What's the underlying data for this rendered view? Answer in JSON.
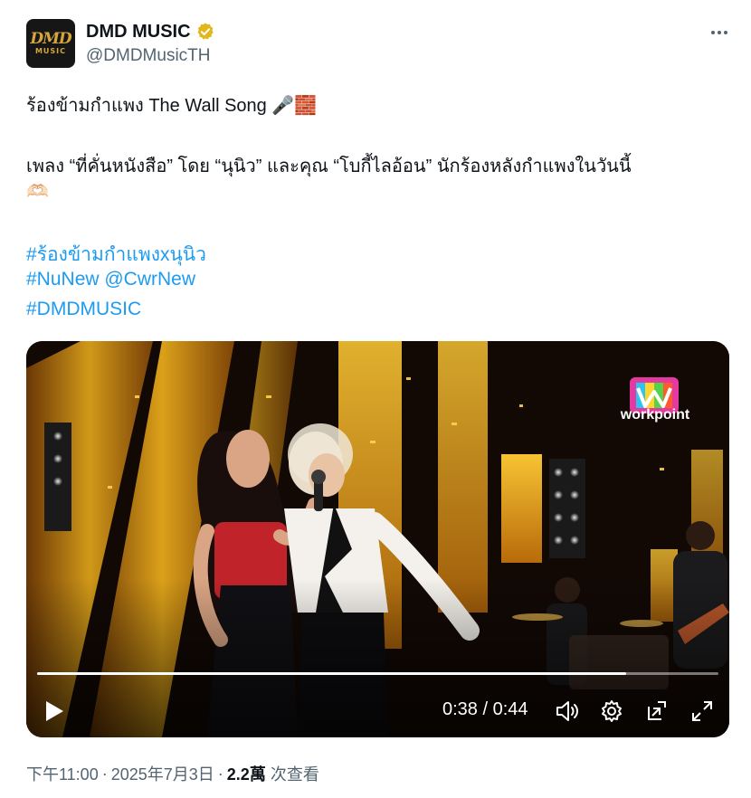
{
  "author": {
    "display_name": "DMD MUSIC",
    "handle": "@DMDMusicTH",
    "avatar_logo_text": "DMD",
    "avatar_logo_subtext": "MUSIC",
    "verified_badge": "gold-verified-icon"
  },
  "tweet": {
    "line1": "ร้องข้ามกำแพง The Wall Song 🎤🧱",
    "line2": "เพลง “ที่คั่นหนังสือ” โดย “นุนิว” และคุณ “โบกี้ไลอ้อน” นักร้องหลังกำแพงในวันนี้",
    "line3": "🫶🏻",
    "hashtags": [
      "#ร้องข้ามกำแพงxนุนิว",
      "#NuNew @CwrNew",
      "#DMDMUSIC"
    ]
  },
  "video": {
    "channel_watermark": "workpoint",
    "time_display": "0:38 / 0:44",
    "progress": 0.864,
    "controls": [
      "play-icon",
      "volume-icon",
      "settings-icon",
      "pip-icon",
      "fullscreen-icon"
    ]
  },
  "meta": {
    "time": "下午11:00",
    "date": "2025年7月3日",
    "separator": "·",
    "views_count": "2.2萬",
    "views_label": "次查看"
  },
  "colors": {
    "link": "#1d9bf0",
    "secondary_text": "#536471",
    "verified_gold": "#e2b719"
  }
}
